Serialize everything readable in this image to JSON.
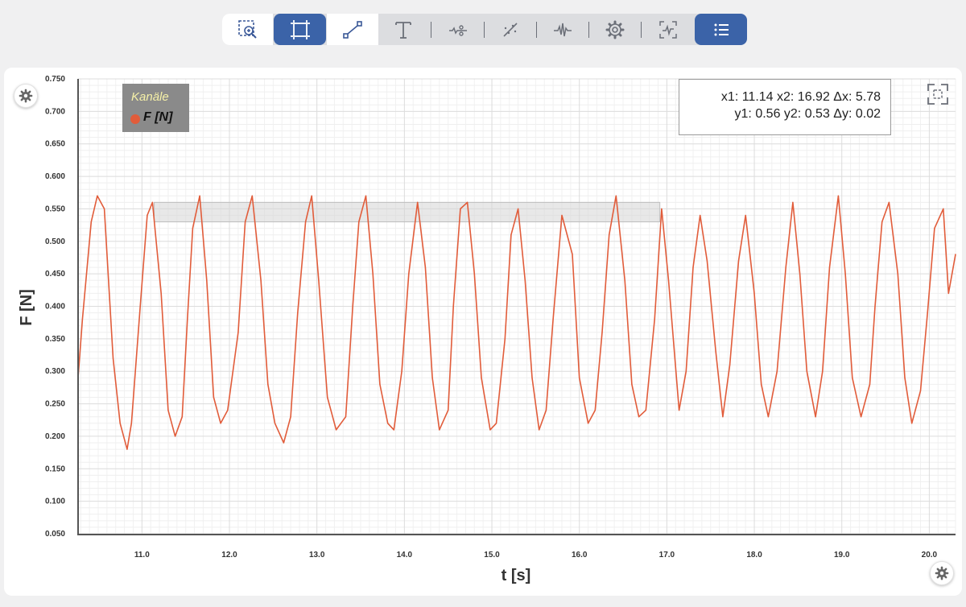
{
  "toolbar": {
    "tools": [
      {
        "name": "zoom-region-icon",
        "active": false
      },
      {
        "name": "select-region-icon",
        "active": true
      },
      {
        "name": "line-tool-icon",
        "active": false
      },
      {
        "name": "text-tool-icon",
        "active": false
      },
      {
        "name": "filter-icon",
        "active": false
      },
      {
        "name": "trend-line-icon",
        "active": false
      },
      {
        "name": "peak-detect-icon",
        "active": false
      },
      {
        "name": "settings-icon",
        "active": false
      },
      {
        "name": "signal-analysis-icon",
        "active": false
      },
      {
        "name": "list-icon",
        "active": true
      }
    ]
  },
  "legend": {
    "title": "Kanäle",
    "channel": "F [N]",
    "channel_color": "#e15c3a"
  },
  "readout": {
    "line1": "x1: 11.14 x2: 16.92 Δx: 5.78",
    "line2": "y1: 0.56 y2: 0.53 Δy: 0.02"
  },
  "chart_data": {
    "type": "line",
    "xlabel": "t [s]",
    "ylabel": "F [N]",
    "xlim": [
      10.27,
      20.3
    ],
    "ylim": [
      0.05,
      0.75
    ],
    "x_ticks": [
      "11.0",
      "12.0",
      "13.0",
      "14.0",
      "15.0",
      "16.0",
      "17.0",
      "18.0",
      "19.0",
      "20.0"
    ],
    "y_ticks": [
      "0.050",
      "0.100",
      "0.150",
      "0.200",
      "0.250",
      "0.300",
      "0.350",
      "0.400",
      "0.450",
      "0.500",
      "0.550",
      "0.600",
      "0.650",
      "0.700",
      "0.750"
    ],
    "grid": true,
    "legend_position": "top-left",
    "colors": {
      "series": "#e15c3a",
      "selection": "#bdbdbd"
    },
    "selection": {
      "x1": 11.14,
      "x2": 16.92,
      "y1": 0.56,
      "y2": 0.53
    },
    "series": [
      {
        "name": "F [N]",
        "x": [
          10.27,
          10.32,
          10.42,
          10.49,
          10.57,
          10.67,
          10.75,
          10.83,
          10.88,
          10.98,
          11.06,
          11.12,
          11.22,
          11.3,
          11.38,
          11.46,
          11.52,
          11.58,
          11.66,
          11.74,
          11.82,
          11.9,
          11.98,
          12.1,
          12.18,
          12.26,
          12.36,
          12.44,
          12.52,
          12.62,
          12.7,
          12.78,
          12.87,
          12.94,
          13.02,
          13.12,
          13.22,
          13.33,
          13.41,
          13.48,
          13.56,
          13.64,
          13.72,
          13.81,
          13.88,
          13.97,
          14.05,
          14.15,
          14.24,
          14.32,
          14.4,
          14.5,
          14.56,
          14.64,
          14.72,
          14.8,
          14.88,
          14.98,
          15.05,
          15.15,
          15.22,
          15.3,
          15.38,
          15.46,
          15.54,
          15.62,
          15.7,
          15.8,
          15.92,
          16.0,
          16.1,
          16.18,
          16.26,
          16.34,
          16.42,
          16.52,
          16.6,
          16.68,
          16.76,
          16.86,
          16.94,
          17.02,
          17.14,
          17.22,
          17.3,
          17.38,
          17.46,
          17.56,
          17.64,
          17.72,
          17.82,
          17.9,
          18.0,
          18.08,
          18.16,
          18.26,
          18.36,
          18.44,
          18.52,
          18.6,
          18.7,
          18.78,
          18.86,
          18.96,
          19.04,
          19.12,
          19.22,
          19.32,
          19.38,
          19.46,
          19.54,
          19.64,
          19.72,
          19.8,
          19.9,
          19.98,
          20.06,
          20.16,
          20.22,
          20.3
        ],
        "values": [
          0.29,
          0.38,
          0.53,
          0.57,
          0.55,
          0.32,
          0.22,
          0.18,
          0.22,
          0.4,
          0.54,
          0.56,
          0.42,
          0.24,
          0.2,
          0.23,
          0.38,
          0.52,
          0.57,
          0.44,
          0.26,
          0.22,
          0.24,
          0.36,
          0.53,
          0.57,
          0.44,
          0.28,
          0.22,
          0.19,
          0.23,
          0.39,
          0.53,
          0.57,
          0.44,
          0.26,
          0.21,
          0.23,
          0.4,
          0.53,
          0.57,
          0.45,
          0.28,
          0.22,
          0.21,
          0.3,
          0.45,
          0.56,
          0.46,
          0.29,
          0.21,
          0.24,
          0.4,
          0.55,
          0.56,
          0.45,
          0.29,
          0.21,
          0.22,
          0.35,
          0.51,
          0.55,
          0.44,
          0.29,
          0.21,
          0.24,
          0.38,
          0.54,
          0.48,
          0.29,
          0.22,
          0.24,
          0.36,
          0.51,
          0.57,
          0.44,
          0.28,
          0.23,
          0.24,
          0.38,
          0.55,
          0.44,
          0.24,
          0.3,
          0.46,
          0.54,
          0.47,
          0.33,
          0.23,
          0.31,
          0.47,
          0.54,
          0.42,
          0.28,
          0.23,
          0.3,
          0.46,
          0.56,
          0.45,
          0.3,
          0.23,
          0.3,
          0.46,
          0.57,
          0.45,
          0.29,
          0.23,
          0.28,
          0.4,
          0.53,
          0.56,
          0.45,
          0.29,
          0.22,
          0.27,
          0.39,
          0.52,
          0.55,
          0.42,
          0.48
        ]
      }
    ]
  }
}
